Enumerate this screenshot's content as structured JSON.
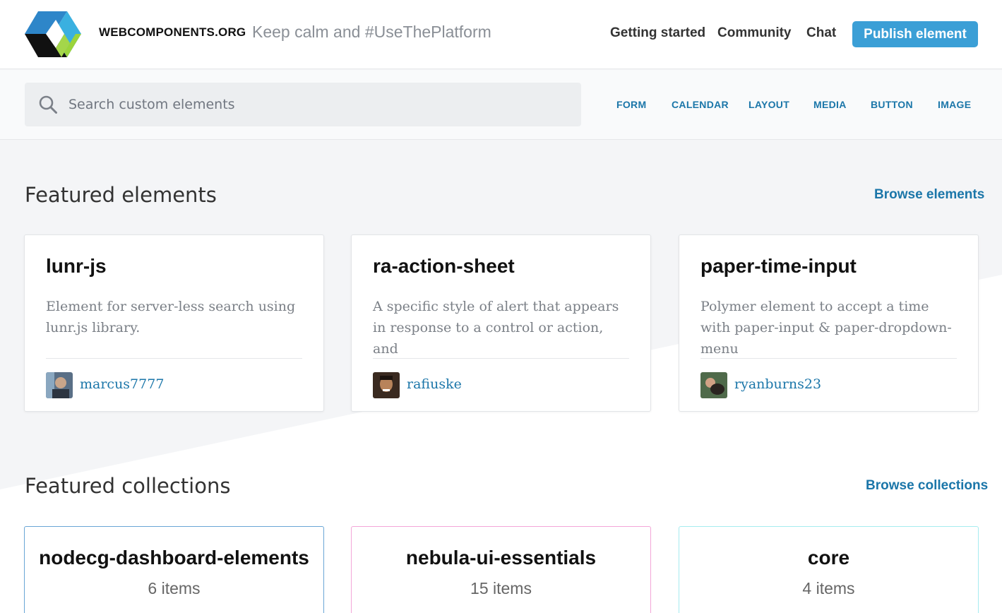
{
  "header": {
    "brand": "WEBCOMPONENTS.ORG",
    "tagline": "Keep calm and #UseThePlatform",
    "nav": [
      "Getting started",
      "Community",
      "Chat"
    ],
    "publish_label": "Publish element"
  },
  "search": {
    "placeholder": "Search custom elements",
    "tags": [
      "FORM",
      "CALENDAR",
      "LAYOUT",
      "MEDIA",
      "BUTTON",
      "IMAGE"
    ]
  },
  "featured_elements": {
    "title": "Featured elements",
    "browse_label": "Browse elements",
    "cards": [
      {
        "name": "lunr-js",
        "description": "Element for server-less search using lunr.js library.",
        "author": "marcus7777"
      },
      {
        "name": "ra-action-sheet",
        "description": "A specific style of alert that appears in response to a control or action, and",
        "author": "rafiuske"
      },
      {
        "name": "paper-time-input",
        "description": "Polymer element to accept a time with paper-input & paper-dropdown-menu",
        "author": "ryanburns23"
      }
    ]
  },
  "featured_collections": {
    "title": "Featured collections",
    "browse_label": "Browse collections",
    "cards": [
      {
        "name": "nodecg-dashboard-elements",
        "count": "6 items",
        "color": "#6aa6d6"
      },
      {
        "name": "nebula-ui-essentials",
        "count": "15 items",
        "color": "#f3a6d8"
      },
      {
        "name": "core",
        "count": "4 items",
        "color": "#a6ecf0"
      }
    ]
  },
  "colors": {
    "accent": "#3b9fd6",
    "link": "#1b76a9"
  }
}
